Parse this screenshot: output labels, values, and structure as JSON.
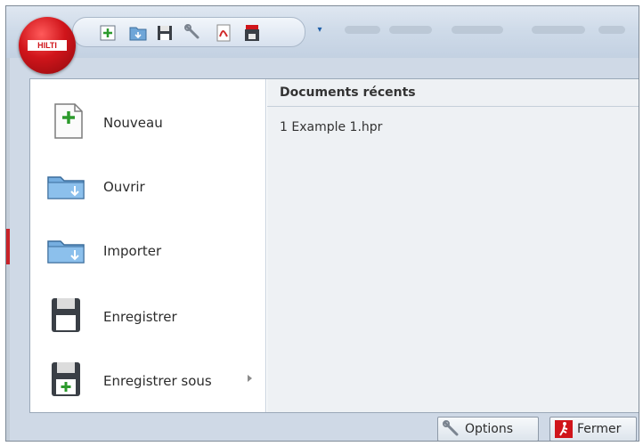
{
  "app": {
    "logo_text": "HILTI"
  },
  "quick_access": {
    "buttons": [
      {
        "name": "new-icon"
      },
      {
        "name": "open-icon"
      },
      {
        "name": "save-icon"
      },
      {
        "name": "wrench-icon"
      },
      {
        "name": "pdf-icon"
      },
      {
        "name": "print-icon"
      }
    ]
  },
  "menu": {
    "items": [
      {
        "label": "Nouveau",
        "icon": "new-document-icon"
      },
      {
        "label": "Ouvrir",
        "icon": "open-folder-icon"
      },
      {
        "label": "Importer",
        "icon": "import-folder-icon"
      },
      {
        "label": "Enregistrer",
        "icon": "save-icon"
      },
      {
        "label": "Enregistrer sous",
        "icon": "save-as-icon",
        "has_submenu": true
      }
    ]
  },
  "recent": {
    "title": "Documents récents",
    "items": [
      "1 Example 1.hpr"
    ]
  },
  "footer": {
    "options_label": "Options",
    "close_label": "Fermer"
  },
  "colors": {
    "brand_red": "#d0151b",
    "frame_blue": "#cfd9e6",
    "recent_bg": "#eef1f4"
  }
}
